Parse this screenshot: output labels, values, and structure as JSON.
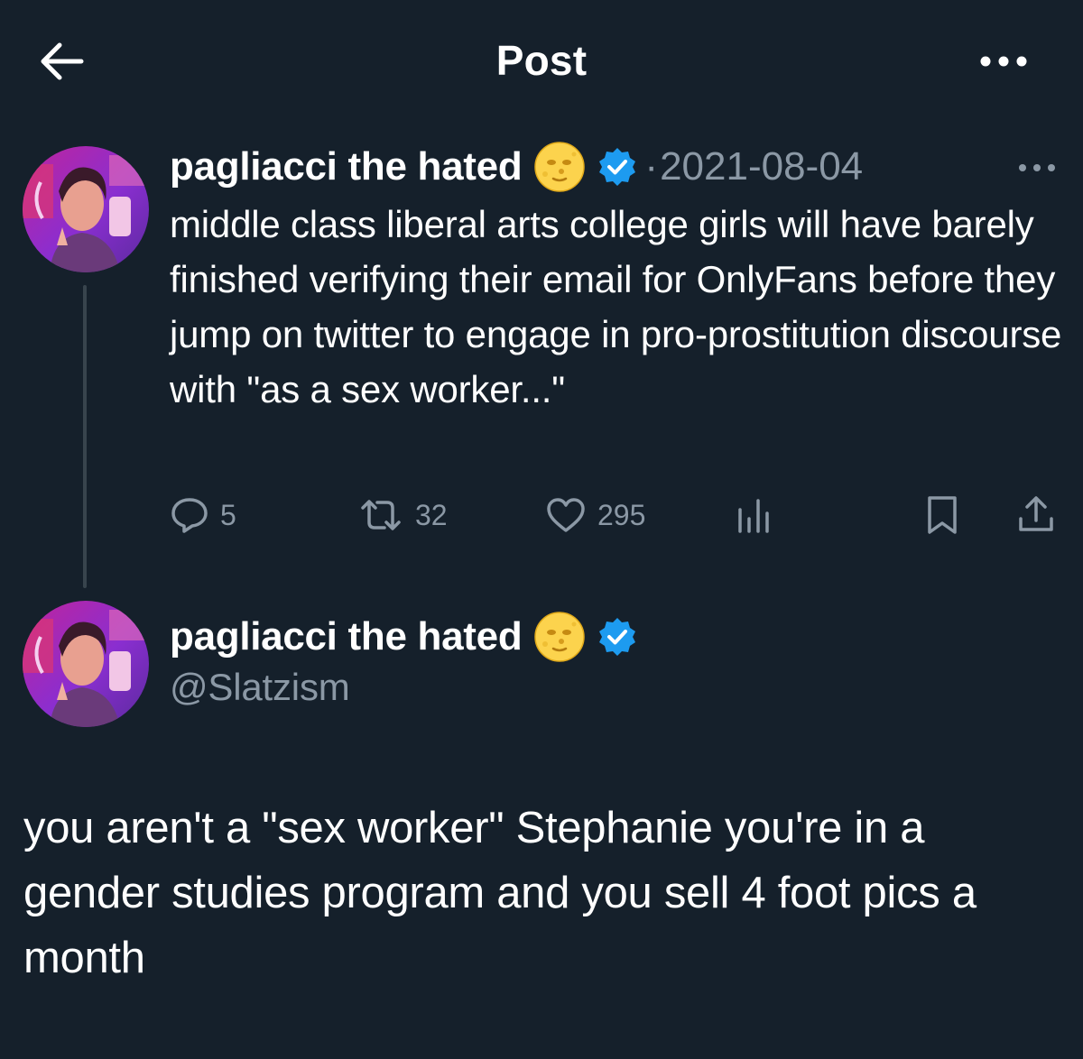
{
  "header": {
    "title": "Post",
    "back_icon": "arrow-left-icon",
    "more_icon": "more-horizontal-icon"
  },
  "quoted_tweet": {
    "display_name": "pagliacci the hated",
    "emoji": "full-moon-face-emoji",
    "verified": true,
    "separator": "·",
    "date": "2021-08-04",
    "text": "middle class liberal arts college girls will have barely finished verifying their email for OnlyFans before they jump on twitter to engage in pro-prostitution discourse with \"as a sex worker...\"",
    "stats": {
      "replies": "5",
      "reposts": "32",
      "likes": "295"
    }
  },
  "main_tweet": {
    "display_name": "pagliacci the hated",
    "emoji": "full-moon-face-emoji",
    "verified": true,
    "handle": "@Slatzism",
    "text": "you aren't a \"sex worker\" Stephanie you're in a gender studies program and you sell 4 foot pics a month"
  },
  "colors": {
    "background": "#15202b",
    "text_primary": "#ffffff",
    "text_secondary": "#8b98a5",
    "verified_blue": "#1d9bf0",
    "thread_line": "#38444d"
  }
}
